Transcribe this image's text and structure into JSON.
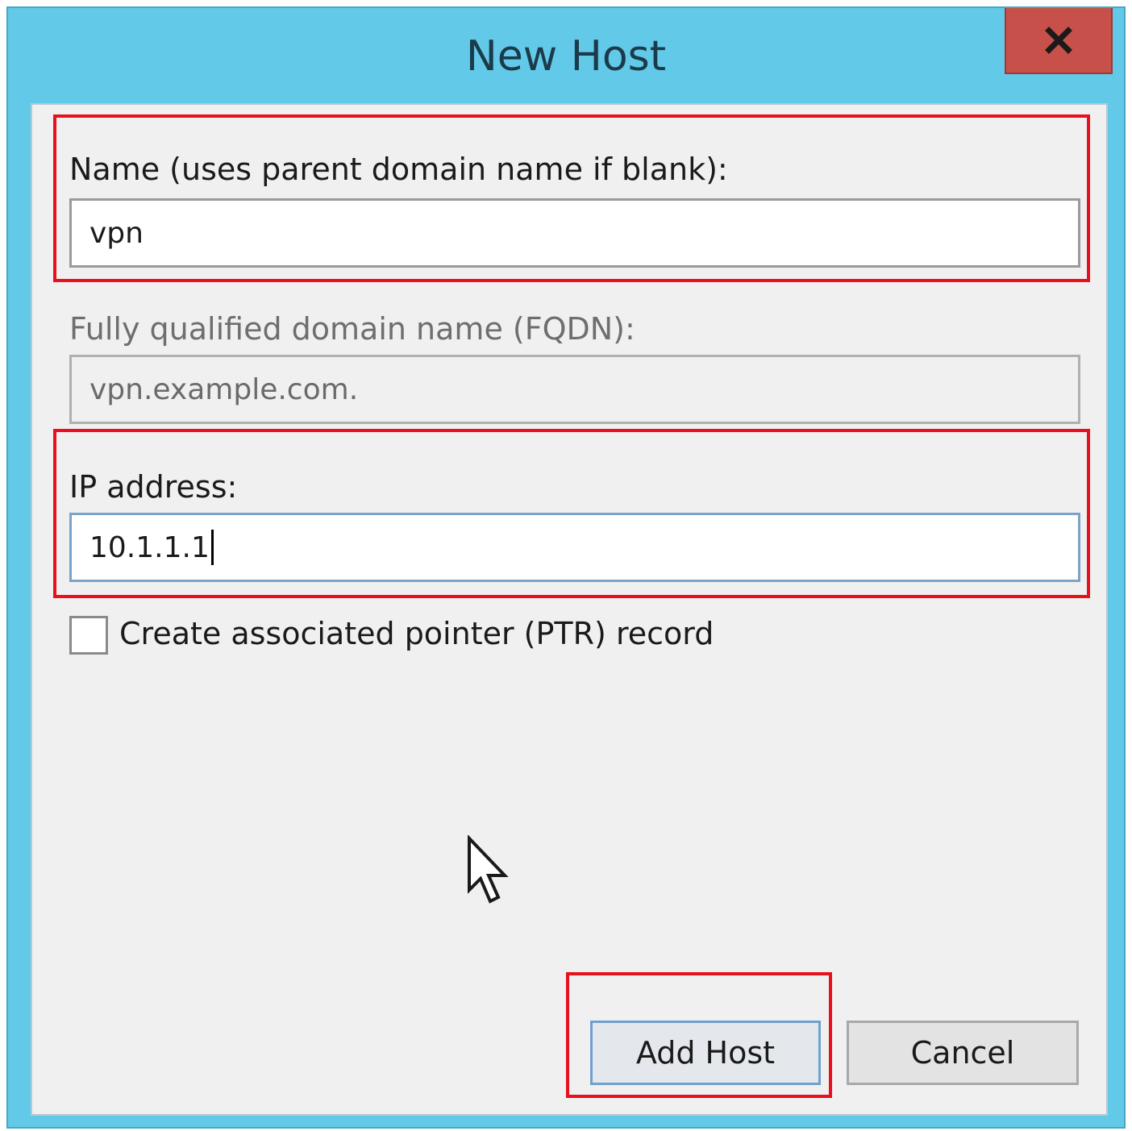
{
  "window": {
    "title": "New Host",
    "close_glyph": "✕"
  },
  "form": {
    "name_label": "Name (uses parent domain name if blank):",
    "name_value": "vpn",
    "fqdn_label": "Fully qualified domain name (FQDN):",
    "fqdn_value": "vpn.example.com.",
    "ip_label": "IP address:",
    "ip_value": "10.1.1.1",
    "ptr_label": "Create associated pointer (PTR) record",
    "ptr_checked": false
  },
  "buttons": {
    "add_host": "Add Host",
    "cancel": "Cancel"
  },
  "colors": {
    "title_bar": "#62c9e8",
    "close_button": "#c7504a",
    "highlight": "#e8101c",
    "client_bg": "#f0f0f0"
  },
  "icons": {
    "close": "close-icon",
    "pointer": "mouse-pointer-icon"
  }
}
